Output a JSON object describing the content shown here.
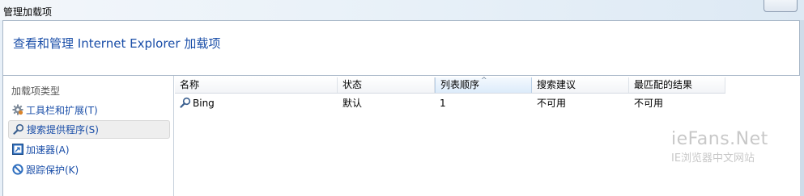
{
  "window": {
    "title": "管理加载项"
  },
  "header": {
    "text": "查看和管理 Internet Explorer 加载项"
  },
  "sidebar": {
    "section_label": "加载项类型",
    "items": [
      {
        "label": "工具栏和扩展(T)",
        "icon": "gear-icon",
        "selected": false
      },
      {
        "label": "搜索提供程序(S)",
        "icon": "search-icon",
        "selected": true
      },
      {
        "label": "加速器(A)",
        "icon": "accelerator-icon",
        "selected": false
      },
      {
        "label": "跟踪保护(K)",
        "icon": "tracking-protection-icon",
        "selected": false
      }
    ]
  },
  "list": {
    "columns": [
      "名称",
      "状态",
      "列表顺序",
      "搜索建议",
      "最匹配的结果"
    ],
    "sorted_column": "列表顺序",
    "sort_direction": "ascending",
    "rows": [
      {
        "name": "Bing",
        "status": "默认",
        "order": "1",
        "suggestions": "不可用",
        "top_result": "不可用",
        "icon": "search-icon"
      }
    ]
  },
  "watermark": {
    "title": "ieFans.Net",
    "subtitle": "IE浏览器中文网站"
  },
  "colors": {
    "link_blue": "#1a4ea8",
    "frame": "#e8f0f8",
    "selection": "#eeeeee"
  }
}
